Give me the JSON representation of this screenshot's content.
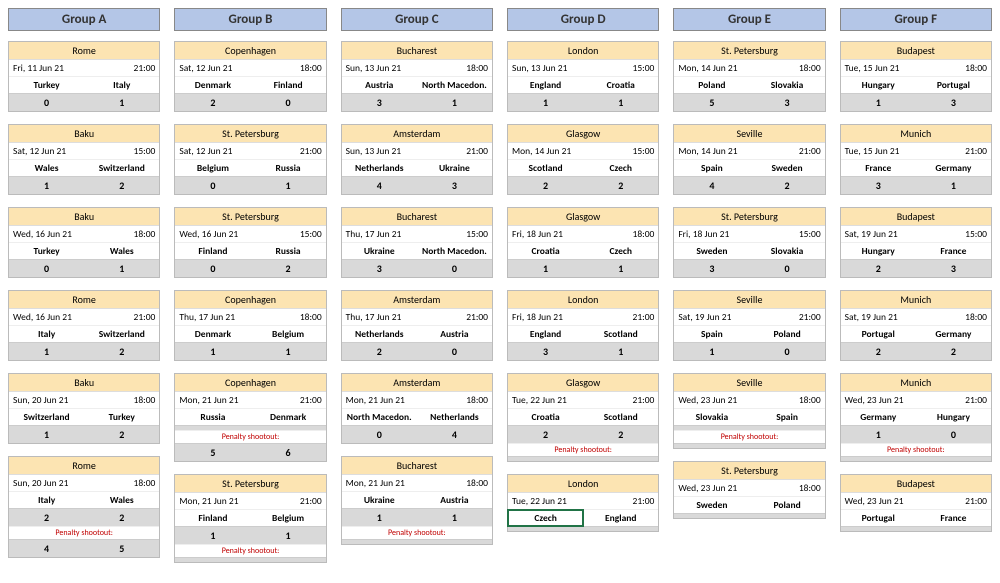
{
  "penalty_label": "Penalty shootout:",
  "groups": [
    {
      "name": "Group A",
      "matches": [
        {
          "city": "Rome",
          "date": "Fri, 11 Jun 21",
          "time": "21:00",
          "home": "Turkey",
          "away": "Italy",
          "hs": "0",
          "as": "1"
        },
        {
          "city": "Baku",
          "date": "Sat, 12 Jun 21",
          "time": "15:00",
          "home": "Wales",
          "away": "Switzerland",
          "hs": "1",
          "as": "2"
        },
        {
          "city": "Baku",
          "date": "Wed, 16 Jun 21",
          "time": "18:00",
          "home": "Turkey",
          "away": "Wales",
          "hs": "0",
          "as": "1"
        },
        {
          "city": "Rome",
          "date": "Wed, 16 Jun 21",
          "time": "21:00",
          "home": "Italy",
          "away": "Switzerland",
          "hs": "1",
          "as": "2"
        },
        {
          "city": "Baku",
          "date": "Sun, 20 Jun 21",
          "time": "18:00",
          "home": "Switzerland",
          "away": "Turkey",
          "hs": "1",
          "as": "2"
        },
        {
          "city": "Rome",
          "date": "Sun, 20 Jun 21",
          "time": "18:00",
          "home": "Italy",
          "away": "Wales",
          "hs": "2",
          "as": "2",
          "pen": true,
          "ph": "4",
          "pa": "5"
        }
      ]
    },
    {
      "name": "Group B",
      "matches": [
        {
          "city": "Copenhagen",
          "date": "Sat, 12 Jun 21",
          "time": "18:00",
          "home": "Denmark",
          "away": "Finland",
          "hs": "2",
          "as": "0"
        },
        {
          "city": "St. Petersburg",
          "date": "Sat, 12 Jun 21",
          "time": "21:00",
          "home": "Belgium",
          "away": "Russia",
          "hs": "0",
          "as": "1"
        },
        {
          "city": "St. Petersburg",
          "date": "Wed, 16 Jun 21",
          "time": "15:00",
          "home": "Finland",
          "away": "Russia",
          "hs": "0",
          "as": "2"
        },
        {
          "city": "Copenhagen",
          "date": "Thu, 17 Jun 21",
          "time": "18:00",
          "home": "Denmark",
          "away": "Belgium",
          "hs": "1",
          "as": "1"
        },
        {
          "city": "Copenhagen",
          "date": "Mon, 21 Jun 21",
          "time": "21:00",
          "home": "Russia",
          "away": "Denmark",
          "hs": "",
          "as": "",
          "pen": true,
          "ph": "5",
          "pa": "6"
        },
        {
          "city": "St. Petersburg",
          "date": "Mon, 21 Jun 21",
          "time": "21:00",
          "home": "Finland",
          "away": "Belgium",
          "hs": "1",
          "as": "1",
          "pen": true,
          "ph": "",
          "pa": ""
        }
      ]
    },
    {
      "name": "Group C",
      "matches": [
        {
          "city": "Bucharest",
          "date": "Sun, 13 Jun 21",
          "time": "18:00",
          "home": "Austria",
          "away": "North Macedon.",
          "hs": "3",
          "as": "1"
        },
        {
          "city": "Amsterdam",
          "date": "Sun, 13 Jun 21",
          "time": "21:00",
          "home": "Netherlands",
          "away": "Ukraine",
          "hs": "4",
          "as": "3"
        },
        {
          "city": "Bucharest",
          "date": "Thu, 17 Jun 21",
          "time": "15:00",
          "home": "Ukraine",
          "away": "North Macedon.",
          "hs": "3",
          "as": "0"
        },
        {
          "city": "Amsterdam",
          "date": "Thu, 17 Jun 21",
          "time": "21:00",
          "home": "Netherlands",
          "away": "Austria",
          "hs": "2",
          "as": "0"
        },
        {
          "city": "Amsterdam",
          "date": "Mon, 21 Jun 21",
          "time": "18:00",
          "home": "North Macedon.",
          "away": "Netherlands",
          "hs": "0",
          "as": "4"
        },
        {
          "city": "Bucharest",
          "date": "Mon, 21 Jun 21",
          "time": "18:00",
          "home": "Ukraine",
          "away": "Austria",
          "hs": "1",
          "as": "1",
          "pen": true,
          "ph": "",
          "pa": ""
        }
      ]
    },
    {
      "name": "Group D",
      "matches": [
        {
          "city": "London",
          "date": "Sun, 13 Jun 21",
          "time": "15:00",
          "home": "England",
          "away": "Croatia",
          "hs": "1",
          "as": "1"
        },
        {
          "city": "Glasgow",
          "date": "Mon, 14 Jun 21",
          "time": "15:00",
          "home": "Scotland",
          "away": "Czech",
          "hs": "2",
          "as": "2"
        },
        {
          "city": "Glasgow",
          "date": "Fri, 18 Jun 21",
          "time": "18:00",
          "home": "Croatia",
          "away": "Czech",
          "hs": "1",
          "as": "1"
        },
        {
          "city": "London",
          "date": "Fri, 18 Jun 21",
          "time": "21:00",
          "home": "England",
          "away": "Scotland",
          "hs": "3",
          "as": "1"
        },
        {
          "city": "Glasgow",
          "date": "Tue, 22 Jun 21",
          "time": "21:00",
          "home": "Croatia",
          "away": "Scotland",
          "hs": "2",
          "as": "2",
          "pen": true,
          "ph": "",
          "pa": ""
        },
        {
          "city": "London",
          "date": "Tue, 22 Jun 21",
          "time": "21:00",
          "home": "Czech",
          "away": "England",
          "hs": "",
          "as": "",
          "selected_home": true
        }
      ]
    },
    {
      "name": "Group E",
      "matches": [
        {
          "city": "St. Petersburg",
          "date": "Mon, 14 Jun 21",
          "time": "18:00",
          "home": "Poland",
          "away": "Slovakia",
          "hs": "5",
          "as": "3"
        },
        {
          "city": "Seville",
          "date": "Mon, 14 Jun 21",
          "time": "21:00",
          "home": "Spain",
          "away": "Sweden",
          "hs": "4",
          "as": "2"
        },
        {
          "city": "St. Petersburg",
          "date": "Fri, 18 Jun 21",
          "time": "15:00",
          "home": "Sweden",
          "away": "Slovakia",
          "hs": "3",
          "as": "0"
        },
        {
          "city": "Seville",
          "date": "Sat, 19 Jun 21",
          "time": "21:00",
          "home": "Spain",
          "away": "Poland",
          "hs": "1",
          "as": "0"
        },
        {
          "city": "Seville",
          "date": "Wed, 23 Jun 21",
          "time": "18:00",
          "home": "Slovakia",
          "away": "Spain",
          "hs": "",
          "as": "",
          "pen": true,
          "ph": "",
          "pa": ""
        },
        {
          "city": "St. Petersburg",
          "date": "Wed, 23 Jun 21",
          "time": "18:00",
          "home": "Sweden",
          "away": "Poland",
          "hs": "",
          "as": ""
        }
      ]
    },
    {
      "name": "Group F",
      "matches": [
        {
          "city": "Budapest",
          "date": "Tue, 15 Jun 21",
          "time": "18:00",
          "home": "Hungary",
          "away": "Portugal",
          "hs": "1",
          "as": "3"
        },
        {
          "city": "Munich",
          "date": "Tue, 15 Jun 21",
          "time": "21:00",
          "home": "France",
          "away": "Germany",
          "hs": "3",
          "as": "1"
        },
        {
          "city": "Budapest",
          "date": "Sat, 19 Jun 21",
          "time": "15:00",
          "home": "Hungary",
          "away": "France",
          "hs": "2",
          "as": "3"
        },
        {
          "city": "Munich",
          "date": "Sat, 19 Jun 21",
          "time": "18:00",
          "home": "Portugal",
          "away": "Germany",
          "hs": "2",
          "as": "2"
        },
        {
          "city": "Munich",
          "date": "Wed, 23 Jun 21",
          "time": "21:00",
          "home": "Germany",
          "away": "Hungary",
          "hs": "1",
          "as": "0",
          "pen": true,
          "ph": "",
          "pa": ""
        },
        {
          "city": "Budapest",
          "date": "Wed, 23 Jun 21",
          "time": "21:00",
          "home": "Portugal",
          "away": "France",
          "hs": "",
          "as": ""
        }
      ]
    }
  ]
}
